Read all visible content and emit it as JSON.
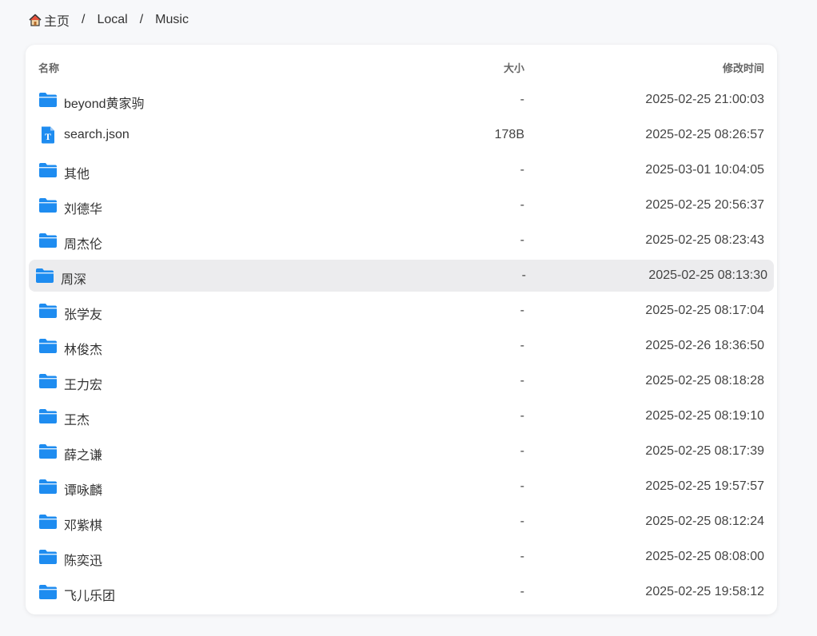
{
  "breadcrumb": {
    "home_label": "主页",
    "home_icon": "home-icon",
    "items": [
      "Local",
      "Music"
    ],
    "separator": "/"
  },
  "table": {
    "columns": {
      "name": "名称",
      "size": "大小",
      "modified": "修改时间"
    },
    "rows": [
      {
        "name": "beyond黄家驹",
        "size": "-",
        "modified": "2025-02-25 21:00:03",
        "type": "folder"
      },
      {
        "name": "search.json",
        "size": "178B",
        "modified": "2025-02-25 08:26:57",
        "type": "text-file"
      },
      {
        "name": "其他",
        "size": "-",
        "modified": "2025-03-01 10:04:05",
        "type": "folder"
      },
      {
        "name": "刘德华",
        "size": "-",
        "modified": "2025-02-25 20:56:37",
        "type": "folder"
      },
      {
        "name": "周杰伦",
        "size": "-",
        "modified": "2025-02-25 08:23:43",
        "type": "folder"
      },
      {
        "name": "周深",
        "size": "-",
        "modified": "2025-02-25 08:13:30",
        "type": "folder",
        "hovered": true
      },
      {
        "name": "张学友",
        "size": "-",
        "modified": "2025-02-25 08:17:04",
        "type": "folder"
      },
      {
        "name": "林俊杰",
        "size": "-",
        "modified": "2025-02-26 18:36:50",
        "type": "folder"
      },
      {
        "name": "王力宏",
        "size": "-",
        "modified": "2025-02-25 08:18:28",
        "type": "folder"
      },
      {
        "name": "王杰",
        "size": "-",
        "modified": "2025-02-25 08:19:10",
        "type": "folder"
      },
      {
        "name": "薛之谦",
        "size": "-",
        "modified": "2025-02-25 08:17:39",
        "type": "folder"
      },
      {
        "name": "谭咏麟",
        "size": "-",
        "modified": "2025-02-25 19:57:57",
        "type": "folder"
      },
      {
        "name": "邓紫棋",
        "size": "-",
        "modified": "2025-02-25 08:12:24",
        "type": "folder"
      },
      {
        "name": "陈奕迅",
        "size": "-",
        "modified": "2025-02-25 08:08:00",
        "type": "folder"
      },
      {
        "name": "飞儿乐团",
        "size": "-",
        "modified": "2025-02-25 19:58:12",
        "type": "folder"
      }
    ]
  },
  "colors": {
    "folder": "#1e8cf0",
    "hover_bg": "#ececee",
    "page_bg": "#f7f8fa"
  }
}
